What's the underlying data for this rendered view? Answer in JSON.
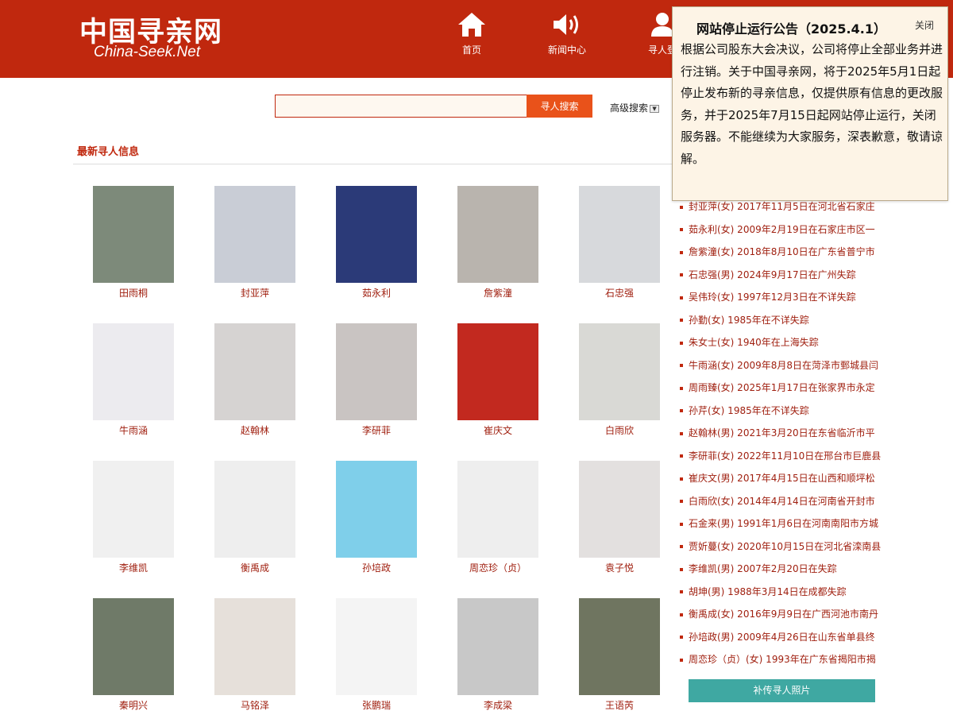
{
  "brand": {
    "name_cn": "中国寻亲网",
    "name_en": "China-Seek.Net"
  },
  "nav": [
    {
      "label": "首页",
      "icon": "home-icon"
    },
    {
      "label": "新闻中心",
      "icon": "speaker-icon"
    },
    {
      "label": "寻人登",
      "icon": "user-icon"
    }
  ],
  "search": {
    "value": "",
    "button_label": "寻人搜索",
    "advanced_label": "高级搜索",
    "advanced_arrow": "▼"
  },
  "section": {
    "title": "最新寻人信息"
  },
  "people": [
    {
      "name": "田雨桐",
      "photo_bg": "#7d8a7a"
    },
    {
      "name": "封亚萍",
      "photo_bg": "#c9cdd6"
    },
    {
      "name": "茹永利",
      "photo_bg": "#2b3a78"
    },
    {
      "name": "詹紫潼",
      "photo_bg": "#b9b4ae"
    },
    {
      "name": "石忠强",
      "photo_bg": "#d7d9dc"
    },
    {
      "name": "牛雨涵",
      "photo_bg": "#ecebef"
    },
    {
      "name": "赵翰林",
      "photo_bg": "#d6d3d2"
    },
    {
      "name": "李研菲",
      "photo_bg": "#c9c4c2"
    },
    {
      "name": "崔庆文",
      "photo_bg": "#c2291f"
    },
    {
      "name": "白雨欣",
      "photo_bg": "#d9d9d5"
    },
    {
      "name": "李维凯",
      "photo_bg": "#f0f0f0"
    },
    {
      "name": "衡禹成",
      "photo_bg": "#eeeeee"
    },
    {
      "name": "孙培政",
      "photo_bg": "#7fcfea"
    },
    {
      "name": "周恋珍（贞）",
      "photo_bg": "#eeeeee"
    },
    {
      "name": "袁子悦",
      "photo_bg": "#e3e0df"
    },
    {
      "name": "秦明兴",
      "photo_bg": "#6f7a68"
    },
    {
      "name": "马铭泽",
      "photo_bg": "#e6e0da"
    },
    {
      "name": "张鹏瑞",
      "photo_bg": "#f4f4f4"
    },
    {
      "name": "李成梁",
      "photo_bg": "#c8c8c8"
    },
    {
      "name": "王语芮",
      "photo_bg": "#6f7560"
    }
  ],
  "list": [
    "封亚萍(女) 2017年11月5日在河北省石家庄",
    "茹永利(女) 2009年2月19日在石家庄市区一",
    "詹紫潼(女) 2018年8月10日在广东省普宁市",
    "石忠强(男) 2024年9月17日在广州失踪",
    "吴伟玲(女) 1997年12月3日在不详失踪",
    "孙勤(女) 1985年在不详失踪",
    "朱女士(女) 1940年在上海失踪",
    "牛雨涵(女) 2009年8月8日在菏泽市鄄城县闫",
    "周雨臻(女) 2025年1月17日在张家界市永定",
    "孙芹(女) 1985年在不详失踪",
    "赵翰林(男) 2021年3月20日在东省临沂市平",
    "李研菲(女) 2022年11月10日在邢台市巨鹿县",
    "崔庆文(男) 2017年4月15日在山西和顺坪松",
    "白雨欣(女) 2014年4月14日在河南省开封市",
    "石金来(男) 1991年1月6日在河南南阳市方城",
    "贾妡蔓(女) 2020年10月15日在河北省滦南县",
    "李维凯(男) 2007年2月20日在失踪",
    "胡坤(男) 1988年3月14日在成都失踪",
    "衡禹成(女) 2016年9月9日在广西河池市南丹",
    "孙培政(男) 2009年4月26日在山东省单县终",
    "周恋珍（贞）(女) 1993年在广东省揭阳市揭"
  ],
  "upload_label": "补传寻人照片",
  "notice": {
    "title": "网站停止运行公告（2025.4.1）",
    "close_label": "关闭",
    "body": "根据公司股东大会决议，公司将停止全部业务并进行注销。关于中国寻亲网，将于2025年5月1日起停止发布新的寻亲信息，仅提供原有信息的更改服务，并于2025年7月15日起网站停止运行，关闭服务器。不能继续为大家服务，深表歉意，敬请谅解。"
  },
  "colors": {
    "brand_red": "#c0280e",
    "search_orange": "#e9521a",
    "link_red": "#a02010",
    "upload_teal": "#3fa8a2",
    "notice_bg": "#fdf4e6"
  }
}
